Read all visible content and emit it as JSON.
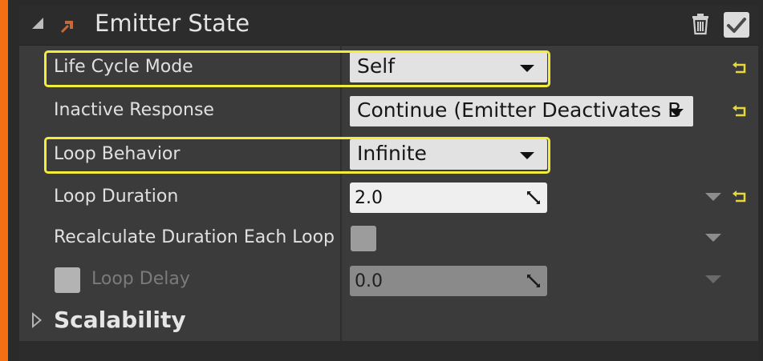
{
  "header": {
    "title": "Emitter State"
  },
  "rows": [
    {
      "label": "Life Cycle Mode",
      "value": "Self"
    },
    {
      "label": "Inactive Response",
      "value": "Continue (Emitter Deactivates B"
    },
    {
      "label": "Loop Behavior",
      "value": "Infinite"
    },
    {
      "label": "Loop Duration",
      "value": "2.0"
    },
    {
      "label": "Recalculate Duration Each Loop"
    },
    {
      "label": "Loop Delay",
      "value": "0.0"
    }
  ],
  "section": {
    "label": "Scalability"
  },
  "colors": {
    "accent": "#f36f13",
    "highlight": "#f4ec3a",
    "reset_icon": "#e7d83a"
  },
  "icons": [
    "collapse-arrow-icon",
    "emitter-icon",
    "trash-icon",
    "checkmark-icon",
    "reset-to-default-icon",
    "dropdown-caret-icon",
    "drag-resize-icon",
    "expand-arrow-icon"
  ]
}
